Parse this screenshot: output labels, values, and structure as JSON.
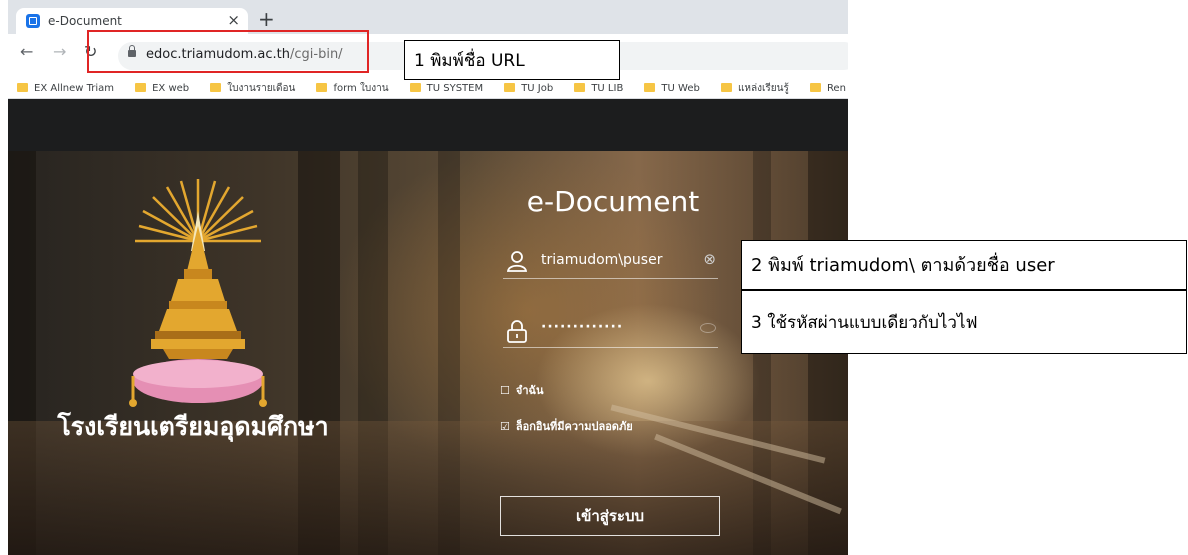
{
  "browser": {
    "tab_title": "e-Document",
    "tab_close": "×",
    "new_tab": "+",
    "url_host": "edoc.triamudom.ac.th",
    "url_path": "/cgi-bin/",
    "bookmarks": [
      "EX Allnew Triam",
      "EX web",
      "ใบงานรายเดือน",
      "form ใบงาน",
      "TU SYSTEM",
      "TU Job",
      "TU LIB",
      "TU Web",
      "แหล่งเรียนรู้",
      "Ren"
    ]
  },
  "page": {
    "school_name": "โรงเรียนเตรียมอุดมศึกษา",
    "login_title": "e-Document",
    "username_value": "triamudom\\puser",
    "password_mask": "·············",
    "remember_label": "จำฉัน",
    "secure_login_label": "ล็อกอินที่มีความปลอดภัย",
    "checkbox_unchecked": "☐",
    "checkbox_checked": "☑",
    "clear_symbol": "⊗",
    "login_button": "เข้าสู่ระบบ"
  },
  "annotations": {
    "step1": "1 พิมพ์ชื่อ URL",
    "step2": "2 พิมพ์ triamudom\\ ตามด้วยชื่อ user",
    "step3": "3 ใช้รหัสผ่านแบบเดียวกับไวไฟ"
  },
  "colors": {
    "highlight": "#e02525",
    "folder": "#f6c544",
    "emblem_gold": "#e3a72f",
    "emblem_pink": "#e58fb4"
  }
}
